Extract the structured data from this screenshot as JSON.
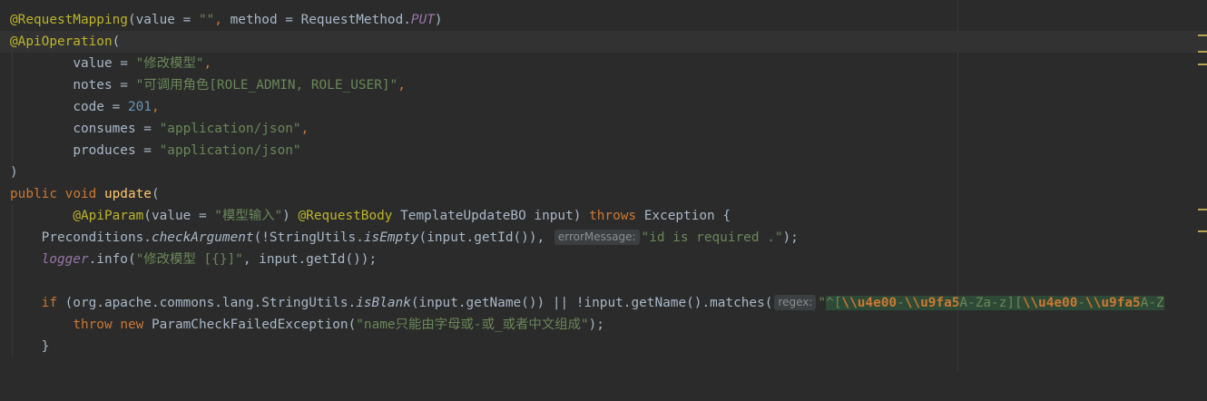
{
  "code": {
    "l1": {
      "annotation": "@RequestMapping",
      "open": "(",
      "value_key": "value",
      "eq1": " = ",
      "value_str": "\"\"",
      "comma": ", ",
      "method_key": "method",
      "eq2": " = ",
      "enum_class": "RequestMethod.",
      "enum_value": "PUT",
      "close": ")"
    },
    "l2": {
      "annotation": "@ApiOperation",
      "open": "("
    },
    "l3": {
      "indent": "        ",
      "key": "value",
      "eq": " = ",
      "str": "\"修改模型\"",
      "comma": ","
    },
    "l4": {
      "indent": "        ",
      "key": "notes",
      "eq": " = ",
      "str": "\"可调用角色[ROLE_ADMIN, ROLE_USER]\"",
      "comma": ","
    },
    "l5": {
      "indent": "        ",
      "key": "code",
      "eq": " = ",
      "num": "201",
      "comma": ","
    },
    "l6": {
      "indent": "        ",
      "key": "consumes",
      "eq": " = ",
      "str": "\"application/json\"",
      "comma": ","
    },
    "l7": {
      "indent": "        ",
      "key": "produces",
      "eq": " = ",
      "str": "\"application/json\""
    },
    "l8": {
      "text": ")"
    },
    "l9": {
      "kw1": "public",
      "sp1": " ",
      "kw2": "void",
      "sp2": " ",
      "fn": "update",
      "open": "("
    },
    "l10": {
      "indent": "        ",
      "ann1": "@ApiParam",
      "p1": "(value = ",
      "str": "\"模型输入\"",
      "p2": ") ",
      "ann2": "@RequestBody",
      "p3": " TemplateUpdateBO input) ",
      "kw": "throws",
      "p4": " Exception {"
    },
    "l11": {
      "indent": "    ",
      "t1": "Preconditions.",
      "m1": "checkArgument",
      "t2": "(!StringUtils.",
      "m2": "isEmpty",
      "t3": "(input.getId()),",
      "hint": "errorMessage:",
      "str": "\"id is required .\"",
      "t4": ");"
    },
    "l12": {
      "indent": "    ",
      "field": "logger",
      "t1": ".info(",
      "str": "\"修改模型 [{}]\"",
      "t2": ", input.getId());"
    },
    "l14": {
      "indent": "    ",
      "kw": "if",
      "t1": " (org.apache.commons.lang.StringUtils.",
      "m1": "isBlank",
      "t2": "(input.getName()) || !input.getName().matches(",
      "hint": "regex:",
      "q": "\"",
      "r1": "^[",
      "e1": "\\\\u4e00",
      "r2": "-",
      "e2": "\\\\u9fa5",
      "r3": "A-Za-z][",
      "e3": "\\\\u4e00",
      "r4": "-",
      "e4": "\\\\u9fa5",
      "r5": "A-Z"
    },
    "l15": {
      "indent": "        ",
      "kw1": "throw",
      "sp": " ",
      "kw2": "new",
      "t1": " ParamCheckFailedException(",
      "str": "\"name只能由字母或-或_或者中文组成\"",
      "t2": ");"
    },
    "l16": {
      "indent": "    ",
      "text": "}"
    }
  },
  "colors": {
    "background": "#2b2b2b",
    "annotation": "#bbb529",
    "keyword": "#cc7832",
    "string": "#6a8759",
    "number": "#6897bb",
    "function": "#ffc66d",
    "text": "#a9b7c6",
    "static_field": "#9876aa"
  }
}
